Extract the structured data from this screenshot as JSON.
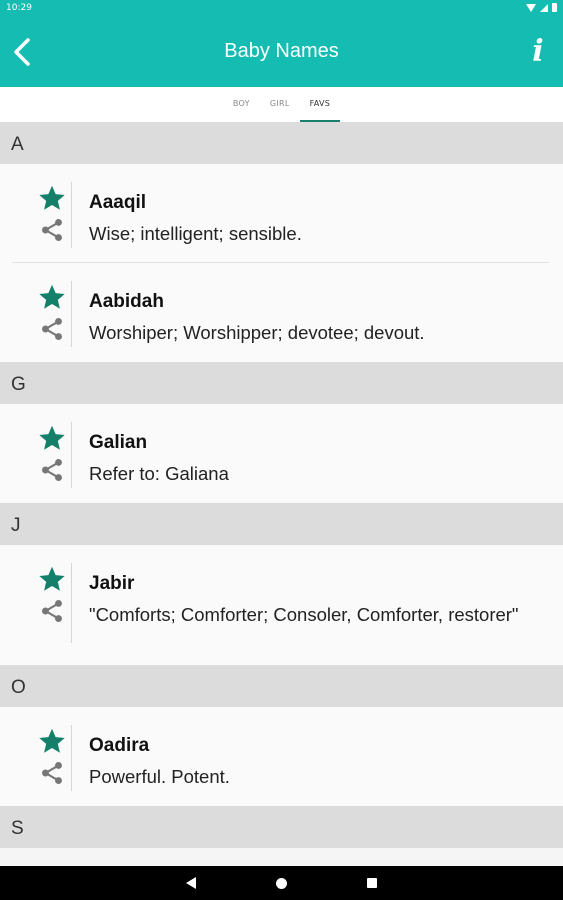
{
  "status": {
    "time": "10:29"
  },
  "app_bar": {
    "title": "Baby Names",
    "back_icon": "back-arrow-icon",
    "info_icon": "i",
    "color": "#15bcb2"
  },
  "tabs": [
    {
      "label": "BOY",
      "active": false
    },
    {
      "label": "GIRL",
      "active": false
    },
    {
      "label": "FAVS",
      "active": true
    }
  ],
  "sections": [
    {
      "letter": "A",
      "entries": [
        {
          "name": "Aaaqil",
          "meaning": "Wise; intelligent; sensible."
        },
        {
          "name": "Aabidah",
          "meaning": "Worshiper; Worshipper; devotee; devout."
        }
      ]
    },
    {
      "letter": "G",
      "entries": [
        {
          "name": "Galian",
          "meaning": "Refer to: Galiana"
        }
      ]
    },
    {
      "letter": "J",
      "entries": [
        {
          "name": "Jabir",
          "meaning": "\"Comforts; Comforter; Consoler, Comforter, restorer\""
        }
      ]
    },
    {
      "letter": "O",
      "entries": [
        {
          "name": "Oadira",
          "meaning": "Powerful. Potent."
        }
      ]
    },
    {
      "letter": "S",
      "entries": []
    }
  ],
  "colors": {
    "star": "#14806a",
    "share": "#777777"
  }
}
